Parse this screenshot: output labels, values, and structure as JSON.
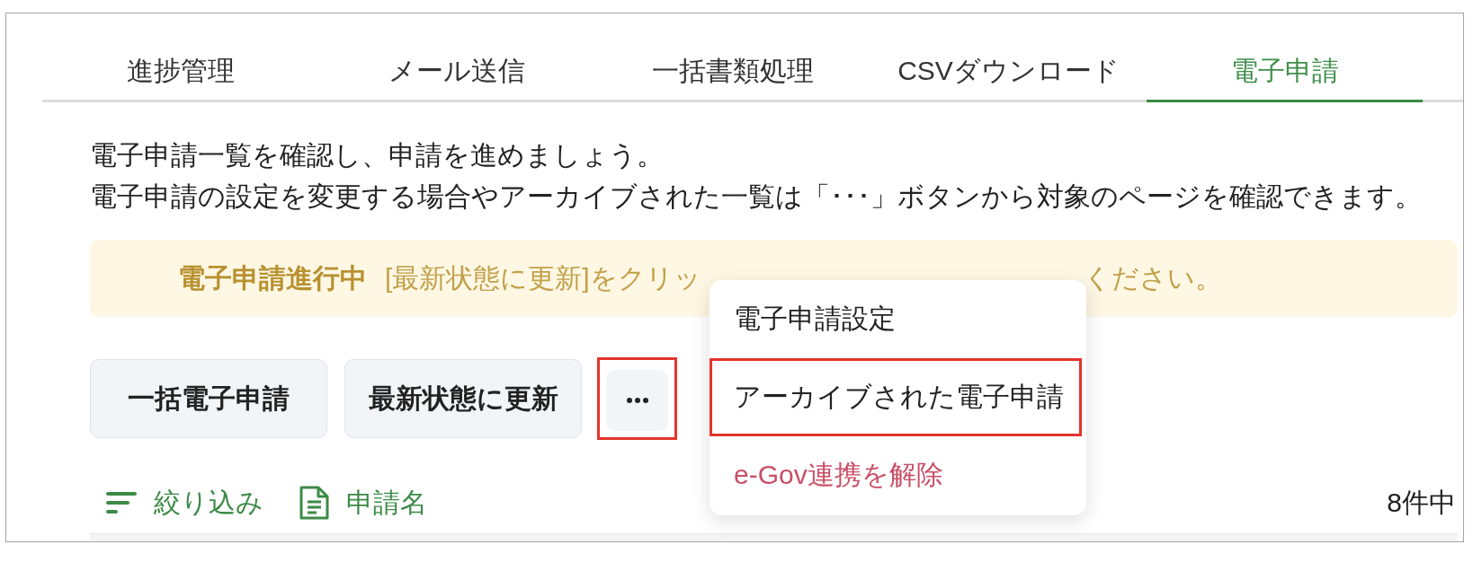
{
  "tabs": [
    {
      "label": "進捗管理",
      "selected": false
    },
    {
      "label": "メール送信",
      "selected": false
    },
    {
      "label": "一括書類処理",
      "selected": false
    },
    {
      "label": "CSVダウンロード",
      "selected": false
    },
    {
      "label": "電子申請",
      "selected": true
    }
  ],
  "description": [
    "電子申請一覧を確認し、申請を進めましょう。",
    "電子申請の設定を変更する場合やアーカイブされた一覧は「･･･」ボタンから対象のページを確認できます。"
  ],
  "notice": {
    "title": "電子申請進行中",
    "text_parts": [
      "[最新状態に更新]をクリッ",
      "ください。"
    ]
  },
  "actions": [
    {
      "label": "一括電子申請"
    },
    {
      "label": "最新状態に更新"
    }
  ],
  "more_button": {
    "highlighted": true
  },
  "menu": {
    "items": [
      {
        "label": "電子申請設定",
        "kind": "normal",
        "highlighted": false
      },
      {
        "label": "アーカイブされた電子申請",
        "kind": "normal",
        "highlighted": true
      },
      {
        "label": "e-Gov連携を解除",
        "kind": "danger",
        "highlighted": false
      }
    ]
  },
  "filters": [
    {
      "label": "絞り込み",
      "kind": "filter"
    },
    {
      "label": "申請名",
      "kind": "document"
    }
  ],
  "result_count": "8件中"
}
